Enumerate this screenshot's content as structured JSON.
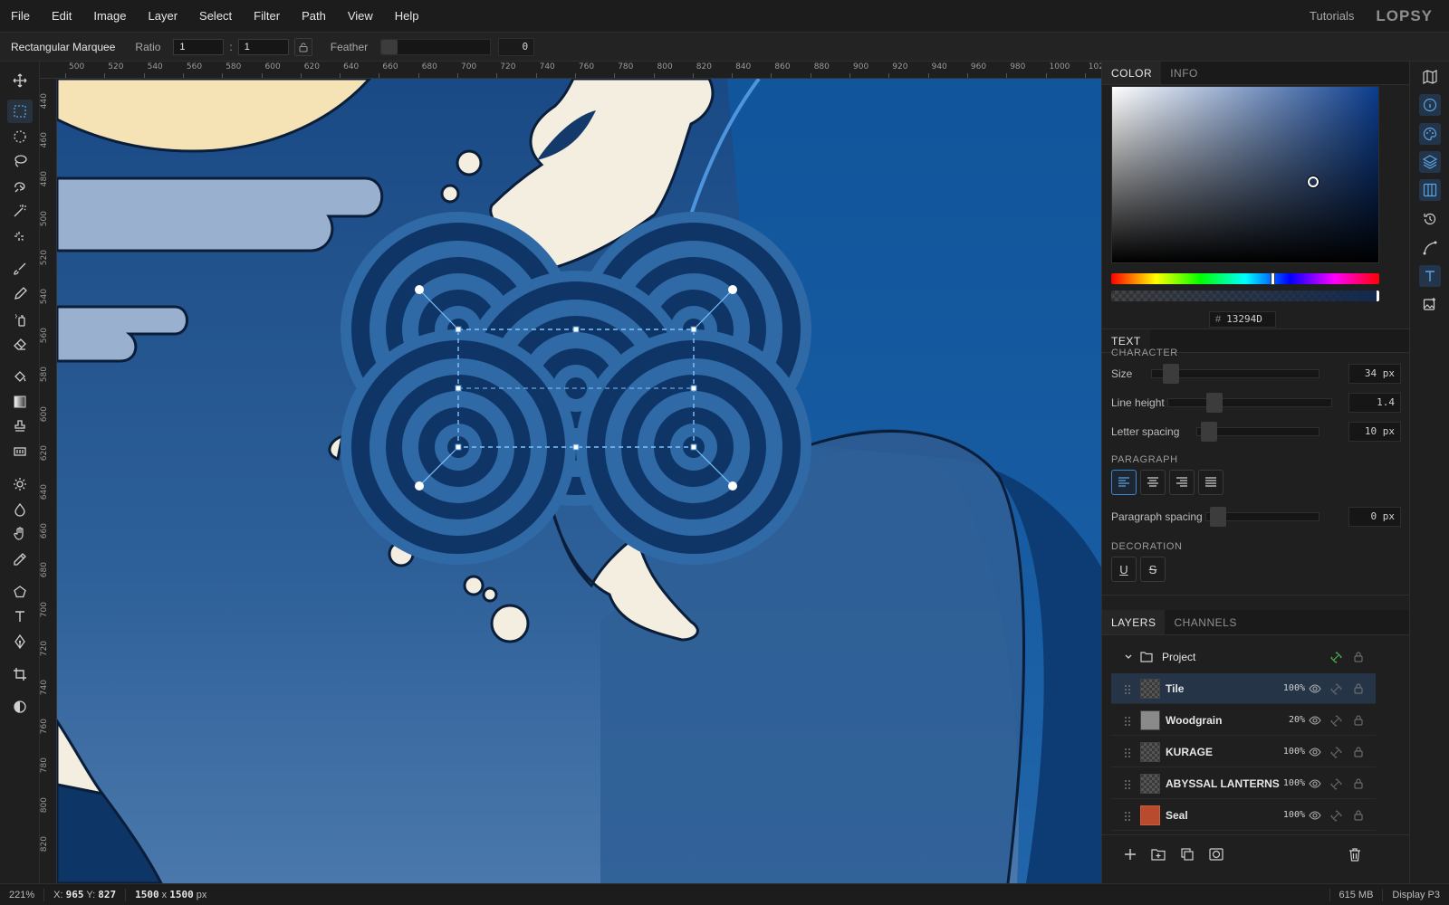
{
  "menu": {
    "items": [
      "File",
      "Edit",
      "Image",
      "Layer",
      "Select",
      "Filter",
      "Path",
      "View",
      "Help"
    ],
    "tutorials": "Tutorials",
    "logo": "LOPSY"
  },
  "options": {
    "tool_name": "Rectangular Marquee",
    "ratio_label": "Ratio",
    "ratio_w": "1",
    "ratio_h": "1",
    "colon": ":",
    "feather_label": "Feather",
    "feather_value": "0",
    "feather_level": 0
  },
  "ruler": {
    "top": [
      "500",
      "520",
      "540",
      "560",
      "580",
      "600",
      "620",
      "640",
      "660",
      "680",
      "700",
      "720",
      "740",
      "760",
      "780",
      "800",
      "820",
      "840",
      "860",
      "880",
      "900",
      "920",
      "940",
      "960",
      "980",
      "1000",
      "102"
    ],
    "left": [
      "440",
      "460",
      "480",
      "500",
      "520",
      "540",
      "560",
      "580",
      "600",
      "620",
      "640",
      "660",
      "680",
      "700",
      "720",
      "740",
      "760",
      "780",
      "800",
      "820"
    ]
  },
  "color_panel": {
    "tabs": [
      "COLOR",
      "INFO"
    ],
    "hex_prefix": "#",
    "hex_value": "13294D",
    "base_hue": "#0b3c8c"
  },
  "text_panel": {
    "title": "TEXT",
    "character_heading": "CHARACTER",
    "size_label": "Size",
    "size_value": "34 px",
    "line_height_label": "Line height",
    "line_height_value": "1.4",
    "letter_spacing_label": "Letter spacing",
    "letter_spacing_value": "10 px",
    "paragraph_heading": "PARAGRAPH",
    "paragraph_spacing_label": "Paragraph spacing",
    "paragraph_spacing_value": "0 px",
    "decoration_heading": "DECORATION",
    "underline": "U",
    "strike": "S"
  },
  "layers_panel": {
    "tabs": [
      "LAYERS",
      "CHANNELS"
    ],
    "group_name": "Project",
    "layers": [
      {
        "name": "Tile",
        "opacity": "100%",
        "selected": true
      },
      {
        "name": "Woodgrain",
        "opacity": "20%",
        "selected": false
      },
      {
        "name": "KURAGE",
        "opacity": "100%",
        "selected": false
      },
      {
        "name": "ABYSSAL LANTERNS",
        "opacity": "100%",
        "selected": false
      },
      {
        "name": "Seal",
        "opacity": "100%",
        "selected": false
      }
    ]
  },
  "status": {
    "zoom": "221%",
    "x_label": "X:",
    "x": "965",
    "y_label": "Y:",
    "y": "827",
    "doc_w": "1500",
    "doc_x": "x",
    "doc_h": "1500",
    "doc_unit": "px",
    "memory": "615 MB",
    "profile": "Display P3"
  },
  "colors": {
    "accent": "#3d87c9",
    "ocean": "#2a5a92",
    "deep": "#0f3566",
    "ring": "#2f6aa6",
    "cream": "#f4eee0",
    "moon": "#f6e3b5",
    "cloud": "#9ab0cf"
  }
}
